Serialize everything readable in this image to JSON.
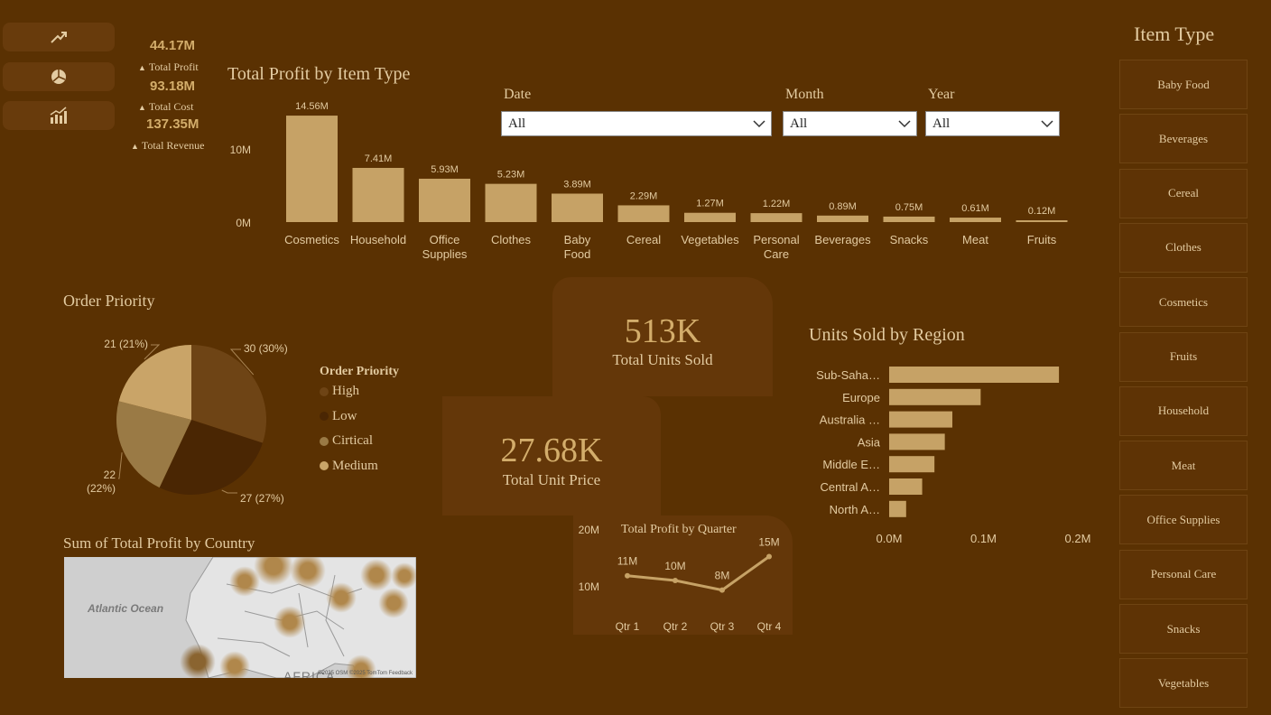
{
  "nav": {
    "icons": [
      "trend-up-icon",
      "pie-chart-icon",
      "bar-growth-icon"
    ]
  },
  "kpis": [
    {
      "value": "44.17M",
      "label": "Total Profit"
    },
    {
      "value": "93.18M",
      "label": "Total Cost"
    },
    {
      "value": "137.35M",
      "label": "Total Revenue"
    }
  ],
  "filters": {
    "date": {
      "label": "Date",
      "value": "All"
    },
    "month": {
      "label": "Month",
      "value": "All"
    },
    "year": {
      "label": "Year",
      "value": "All"
    }
  },
  "slicer": {
    "title": "Item Type",
    "items": [
      "Baby Food",
      "Beverages",
      "Cereal",
      "Clothes",
      "Cosmetics",
      "Fruits",
      "Household",
      "Meat",
      "Office Supplies",
      "Personal Care",
      "Snacks",
      "Vegetables"
    ]
  },
  "cards": {
    "units": {
      "value": "513K",
      "label": "Total Units Sold"
    },
    "price": {
      "value": "27.68K",
      "label": "Total Unit Price"
    }
  },
  "map": {
    "title": "Sum of Total Profit by Country",
    "ocean_label": "Atlantic Ocean",
    "continent_label": "AFRICA",
    "attribution": "©2025 OSM  ©2025 TomTom  Feedback"
  },
  "colors": {
    "background": "#5a3102",
    "bar": "#c6a266",
    "text": "#e3cba1"
  },
  "chart_data": [
    {
      "id": "profit_by_item",
      "type": "bar",
      "title": "Total Profit by Item Type",
      "categories": [
        "Cosmetics",
        "Household",
        "Office Supplies",
        "Clothes",
        "Baby Food",
        "Cereal",
        "Vegetables",
        "Personal Care",
        "Beverages",
        "Snacks",
        "Meat",
        "Fruits"
      ],
      "values": [
        14.56,
        7.41,
        5.93,
        5.23,
        3.89,
        2.29,
        1.27,
        1.22,
        0.89,
        0.75,
        0.61,
        0.12
      ],
      "labels": [
        "14.56M",
        "7.41M",
        "5.93M",
        "5.23M",
        "3.89M",
        "2.29M",
        "1.27M",
        "1.22M",
        "0.89M",
        "0.75M",
        "0.61M",
        "0.12M"
      ],
      "yticks": [
        "0M",
        "10M"
      ],
      "ylim": [
        0,
        15
      ]
    },
    {
      "id": "order_priority",
      "type": "pie",
      "title": "Order Priority",
      "legend_title": "Order Priority",
      "legend": [
        "High",
        "Low",
        "Cirtical",
        "Medium"
      ],
      "slices": [
        {
          "name": "High",
          "value": 30,
          "label": "30 (30%)",
          "color": "#6e4415"
        },
        {
          "name": "Low",
          "value": 27,
          "label": "27 (27%)",
          "color": "#4a2603"
        },
        {
          "name": "Cirtical",
          "value": 22,
          "label": "22 (22%)",
          "color": "#9a7a45"
        },
        {
          "name": "Medium",
          "value": 21,
          "label": "21 (21%)",
          "color": "#c9a468"
        }
      ]
    },
    {
      "id": "units_by_region",
      "type": "bar",
      "orientation": "horizontal",
      "title": "Units Sold by Region",
      "categories": [
        "Sub-Saha…",
        "Europe",
        "Australia …",
        "Asia",
        "Middle E…",
        "Central A…",
        "North A…"
      ],
      "values": [
        0.18,
        0.097,
        0.067,
        0.059,
        0.048,
        0.035,
        0.018
      ],
      "xticks": [
        "0.0M",
        "0.1M",
        "0.2M"
      ],
      "xlim": [
        0,
        0.2
      ]
    },
    {
      "id": "profit_by_quarter",
      "type": "line",
      "title": "Total Profit by Quarter",
      "categories": [
        "Qtr 1",
        "Qtr 2",
        "Qtr 3",
        "Qtr 4"
      ],
      "values": [
        11,
        10,
        8,
        15
      ],
      "labels": [
        "11M",
        "10M",
        "8M",
        "15M"
      ],
      "yticks": [
        "10M",
        "20M"
      ],
      "ylim": [
        0,
        20
      ]
    }
  ]
}
